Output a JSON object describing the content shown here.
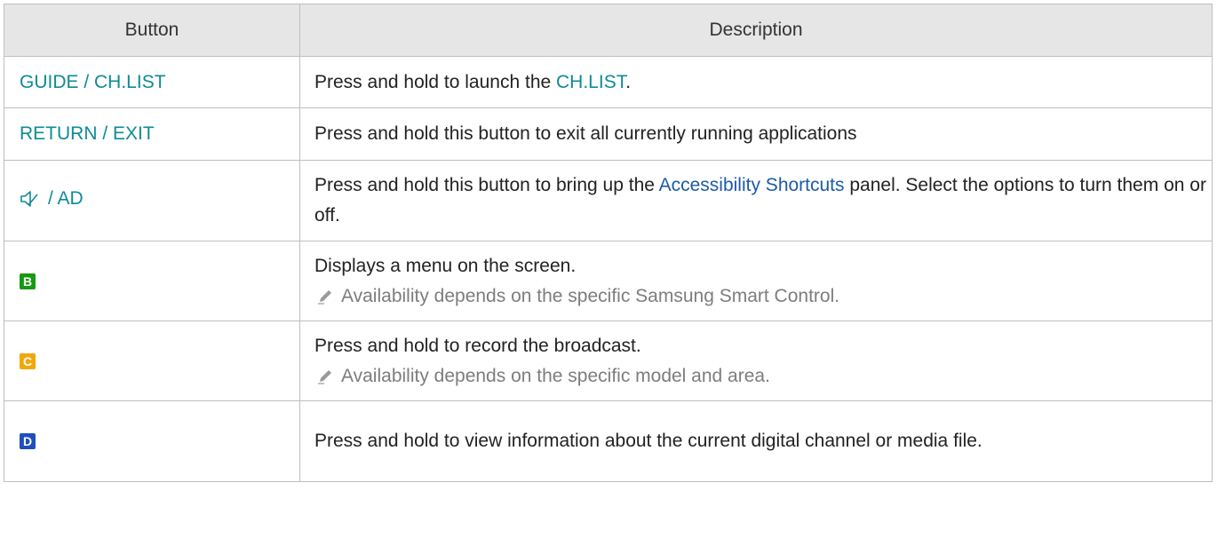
{
  "table": {
    "headers": {
      "button": "Button",
      "description": "Description"
    },
    "rows": [
      {
        "button": "GUIDE / CH.LIST",
        "desc_prefix": "Press and hold to launch the ",
        "desc_link": "CH.LIST",
        "desc_suffix": "."
      },
      {
        "button": "RETURN / EXIT",
        "desc": "Press and hold this button to exit all currently running applications"
      },
      {
        "button_icon": "audio-description-icon",
        "button": "/ AD",
        "desc_prefix": "Press and hold this button to bring up the ",
        "desc_link": "Accessibility Shortcuts",
        "desc_suffix": " panel. Select the options to turn them on or off."
      },
      {
        "key": "B",
        "key_color": "#169a12",
        "desc": "Displays a menu on the screen.",
        "note_icon": "pencil-note-icon",
        "note": "Availability depends on the specific Samsung Smart Control."
      },
      {
        "key": "C",
        "key_color": "#f2a80a",
        "desc": "Press and hold to record the broadcast.",
        "note_icon": "pencil-note-icon",
        "note": "Availability depends on the specific model and area."
      },
      {
        "key": "D",
        "key_color": "#1f4fbf",
        "desc": "Press and hold to view information about the current digital channel or media file."
      }
    ]
  },
  "colors": {
    "header_bg": "#e6e6e6",
    "button_text": "#0e8b96",
    "link_text": "#1d5aa8",
    "note_text": "#7d7d7d",
    "border": "#bfbfbf"
  }
}
